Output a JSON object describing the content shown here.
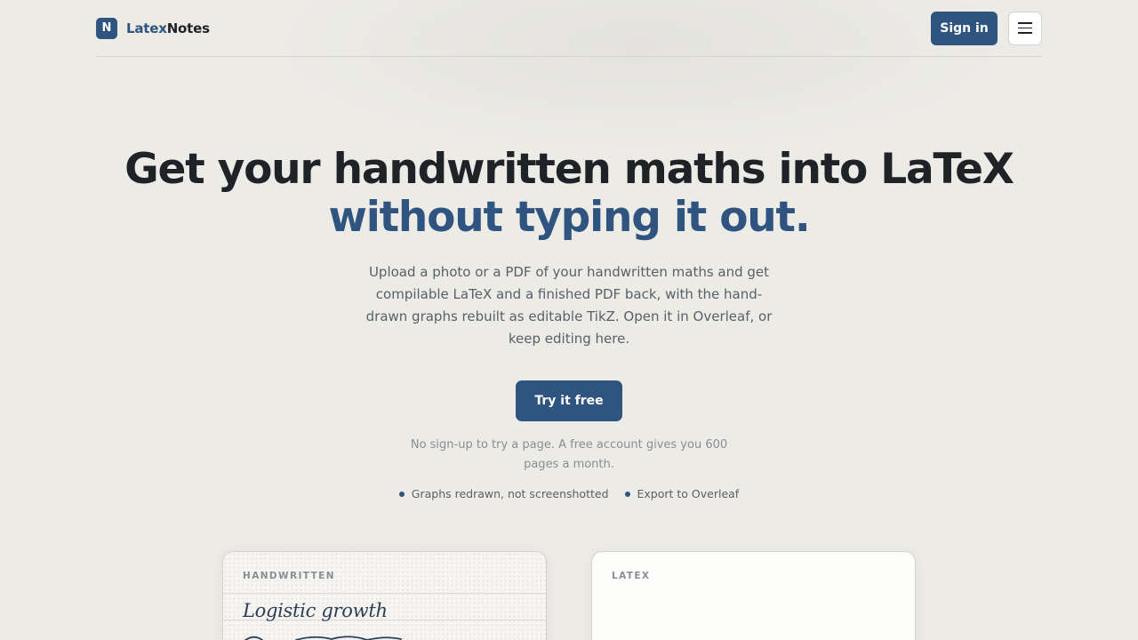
{
  "brand": {
    "mark": "N",
    "name_part1": "Latex",
    "name_part2": "Notes"
  },
  "nav": {
    "signin_label": "Sign in",
    "menu_icon": "hamburger-menu-icon"
  },
  "hero": {
    "title_line1": "Get your handwritten maths into LaTeX",
    "title_line2": "without typing it out.",
    "subtitle": "Upload a photo or a PDF of your handwritten maths and get compilable LaTeX and a finished PDF back, with the hand-drawn graphs rebuilt as editable TikZ. Open it in Overleaf, or keep editing here.",
    "cta_label": "Try it free",
    "cta_note": "No sign-up to try a page. A free account gives you 600 pages a month.",
    "features": [
      "Graphs redrawn, not screenshotted",
      "Export to Overleaf"
    ]
  },
  "panels": {
    "handwritten": {
      "label": "HANDWRITTEN",
      "text": "Logistic growth"
    },
    "latex": {
      "label": "LATEX"
    }
  },
  "colors": {
    "accent": "#2f5480",
    "background": "#ecebe6",
    "text": "#1f2328",
    "muted": "#59606a"
  }
}
